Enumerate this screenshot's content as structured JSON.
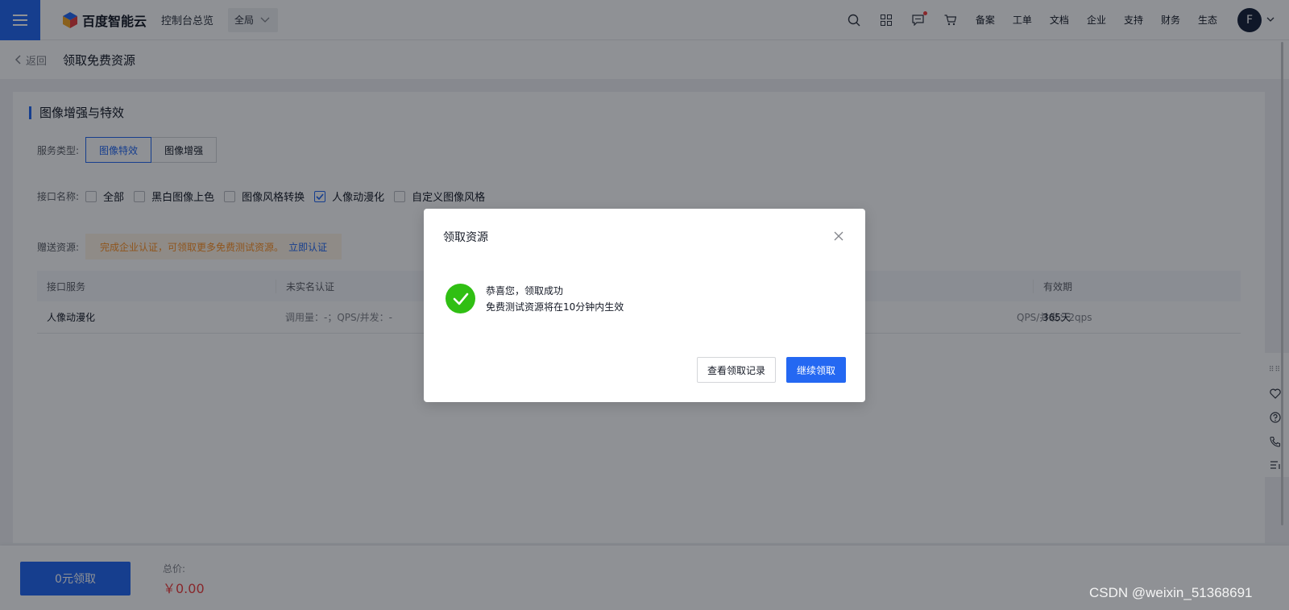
{
  "header": {
    "logo_text": "百度智能云",
    "overview": "控制台总览",
    "region": "全局",
    "nav_links": [
      "备案",
      "工单",
      "文档",
      "企业",
      "支持",
      "财务",
      "生态"
    ],
    "avatar_initial": "F"
  },
  "subheader": {
    "back_label": "返回",
    "page_title": "领取免费资源"
  },
  "section": {
    "title": "图像增强与特效",
    "service_type_label": "服务类型:",
    "service_types": [
      {
        "label": "图像特效",
        "active": true
      },
      {
        "label": "图像增强",
        "active": false
      }
    ],
    "api_name_label": "接口名称:",
    "apis": [
      {
        "label": "全部",
        "checked": false
      },
      {
        "label": "黑白图像上色",
        "checked": false
      },
      {
        "label": "图像风格转换",
        "checked": false
      },
      {
        "label": "人像动漫化",
        "checked": true
      },
      {
        "label": "自定义图像风格",
        "checked": false
      }
    ],
    "gift_label": "赠送资源:",
    "gift_notice": "完成企业认证，可领取更多免费测试资源。",
    "gift_link": "立即认证"
  },
  "table": {
    "headers": [
      "接口服务",
      "未实名认证",
      "",
      "有效期"
    ],
    "rows": [
      [
        "人像动漫化",
        "调用量：-；QPS/并发：-",
        "QPS/并发：2qps",
        "365天"
      ]
    ]
  },
  "footer": {
    "claim_button": "0元领取",
    "total_label": "总价:",
    "total_value": "￥0.00"
  },
  "modal": {
    "title": "领取资源",
    "success_title": "恭喜您，领取成功",
    "success_sub": "免费测试资源将在10分钟内生效",
    "records_button": "查看领取记录",
    "continue_button": "继续领取"
  },
  "watermark": "CSDN @weixin_51368691",
  "colors": {
    "primary": "#2468f2",
    "success": "#30bf13",
    "price": "#f33e3e",
    "notice": "#ff9326"
  }
}
